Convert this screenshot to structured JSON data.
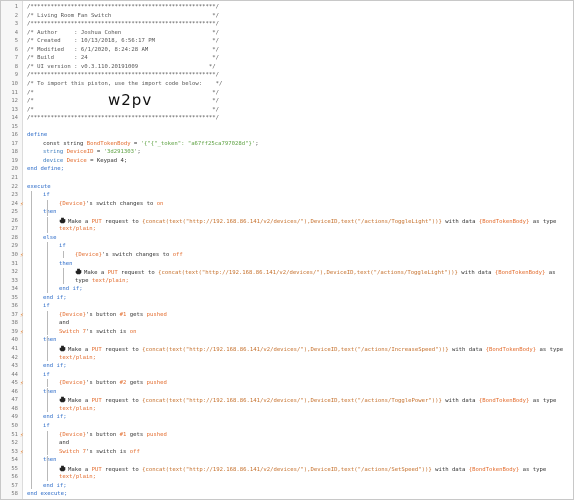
{
  "editor": {
    "lines": [
      {
        "n": "1",
        "i": 0,
        "c": "cm",
        "p": [
          [
            "/*******************************************************/"
          ]
        ]
      },
      {
        "n": "2",
        "i": 0,
        "c": "cm",
        "p": [
          [
            "/* Living Room Fan Switch                              */"
          ]
        ]
      },
      {
        "n": "3",
        "i": 0,
        "c": "cm",
        "p": [
          [
            "/*******************************************************/"
          ]
        ]
      },
      {
        "n": "4",
        "i": 0,
        "c": "cm",
        "p": [
          [
            "/* Author     : Joshua Cohen                           */"
          ]
        ]
      },
      {
        "n": "5",
        "i": 0,
        "c": "cm",
        "p": [
          [
            "/* Created    : 10/13/2018, 6:56:17 PM                 */"
          ]
        ]
      },
      {
        "n": "6",
        "i": 0,
        "c": "cm",
        "p": [
          [
            "/* Modified   : 6/1/2020, 8:24:28 AM                   */"
          ]
        ]
      },
      {
        "n": "7",
        "i": 0,
        "c": "cm",
        "p": [
          [
            "/* Build      : 24                                     */"
          ]
        ]
      },
      {
        "n": "8",
        "i": 0,
        "c": "cm",
        "p": [
          [
            "/* UI version : v0.3.110.20191009                     */"
          ]
        ]
      },
      {
        "n": "9",
        "i": 0,
        "c": "cm",
        "p": [
          [
            "/*******************************************************/"
          ]
        ]
      },
      {
        "n": "10",
        "i": 0,
        "c": "cm",
        "p": [
          [
            "/* To import this piston, use the import code below:    */"
          ]
        ]
      },
      {
        "n": "11",
        "i": 0,
        "c": "cm",
        "p": [
          [
            "/*                                                     */"
          ]
        ]
      },
      {
        "n": "12",
        "i": 0,
        "c": "cm",
        "p": [
          [
            "/*                                                     */"
          ]
        ]
      },
      {
        "n": "13",
        "i": 0,
        "c": "cm",
        "p": [
          [
            "/*                                                     */"
          ]
        ]
      },
      {
        "n": "14",
        "i": 0,
        "c": "cm",
        "p": [
          [
            "/*******************************************************/"
          ]
        ]
      },
      {
        "n": "15",
        "i": 0,
        "c": "",
        "p": []
      },
      {
        "n": "16",
        "i": 0,
        "c": "kw",
        "p": [
          [
            "define"
          ]
        ]
      },
      {
        "n": "17",
        "i": 1,
        "c": "",
        "p": [
          [
            "const string ",
            ""
          ],
          [
            "BondTokenBody",
            "var"
          ],
          [
            " = ",
            ""
          ],
          [
            "'{\"{\"_token\": \"a67ff25ca797028d\"}'",
            "str"
          ],
          [
            ";",
            ""
          ]
        ]
      },
      {
        "n": "18",
        "i": 1,
        "c": "",
        "p": [
          [
            "string ",
            "typ"
          ],
          [
            "DeviceID",
            "var"
          ],
          [
            " = ",
            ""
          ],
          [
            "'3d291303'",
            "str"
          ],
          [
            ";",
            ""
          ]
        ]
      },
      {
        "n": "19",
        "i": 1,
        "c": "",
        "p": [
          [
            "device ",
            "typ"
          ],
          [
            "Device",
            "var"
          ],
          [
            " = Keypad 4;",
            ""
          ]
        ]
      },
      {
        "n": "20",
        "i": 0,
        "c": "kw",
        "p": [
          [
            "end define;"
          ]
        ]
      },
      {
        "n": "21",
        "i": 0,
        "c": "",
        "p": []
      },
      {
        "n": "22",
        "i": 0,
        "c": "kw",
        "p": [
          [
            "execute"
          ]
        ]
      },
      {
        "n": "23",
        "i": 1,
        "c": "kw",
        "p": [
          [
            "if"
          ]
        ]
      },
      {
        "n": "24",
        "i": 2,
        "c": "",
        "f": true,
        "p": [
          [
            "{Device}",
            "var"
          ],
          [
            "'s switch changes to ",
            ""
          ],
          [
            "on",
            "var"
          ]
        ]
      },
      {
        "n": "25",
        "i": 1,
        "c": "kw",
        "p": [
          [
            "then"
          ]
        ]
      },
      {
        "n": "26",
        "i": 2,
        "c": "",
        "ic": true,
        "p": [
          [
            "Make a ",
            ""
          ],
          [
            "PUT",
            "var"
          ],
          [
            " request to ",
            ""
          ],
          [
            "{concat(text(\"http://192.168.86.141/v2/devices/\"),DeviceID,text(\"/actions/ToggleLight\"))}",
            "str2"
          ],
          [
            " with data ",
            ""
          ],
          [
            "{BondTokenBody}",
            "var"
          ],
          [
            " as type",
            ""
          ]
        ]
      },
      {
        "n": "27",
        "i": 2,
        "c": "",
        "p": [
          [
            "text/plain;",
            "var"
          ]
        ]
      },
      {
        "n": "28",
        "i": 1,
        "c": "kw",
        "p": [
          [
            "else"
          ]
        ]
      },
      {
        "n": "29",
        "i": 2,
        "c": "kw",
        "p": [
          [
            "if"
          ]
        ]
      },
      {
        "n": "30",
        "i": 3,
        "c": "",
        "f": true,
        "p": [
          [
            "{Device}",
            "var"
          ],
          [
            "'s switch changes to ",
            ""
          ],
          [
            "off",
            "var"
          ]
        ]
      },
      {
        "n": "31",
        "i": 2,
        "c": "kw",
        "p": [
          [
            "then"
          ]
        ]
      },
      {
        "n": "32",
        "i": 3,
        "c": "",
        "ic": true,
        "p": [
          [
            "Make a ",
            ""
          ],
          [
            "PUT",
            "var"
          ],
          [
            " request to ",
            ""
          ],
          [
            "{concat(text(\"http://192.168.86.141/v2/devices/\"),DeviceID,text(\"/actions/ToggleLight\"))}",
            "str2"
          ],
          [
            " with data ",
            ""
          ],
          [
            "{BondTokenBody}",
            "var"
          ],
          [
            " as",
            ""
          ]
        ]
      },
      {
        "n": "33",
        "i": 3,
        "c": "",
        "p": [
          [
            "type ",
            ""
          ],
          [
            "text/plain;",
            "var"
          ]
        ]
      },
      {
        "n": "34",
        "i": 2,
        "c": "kw",
        "p": [
          [
            "end if;"
          ]
        ]
      },
      {
        "n": "35",
        "i": 1,
        "c": "kw",
        "p": [
          [
            "end if;"
          ]
        ]
      },
      {
        "n": "36",
        "i": 1,
        "c": "kw",
        "p": [
          [
            "if"
          ]
        ]
      },
      {
        "n": "37",
        "i": 2,
        "c": "",
        "f": true,
        "p": [
          [
            "{Device}",
            "var"
          ],
          [
            "'s button ",
            ""
          ],
          [
            "#1",
            "var"
          ],
          [
            " gets ",
            ""
          ],
          [
            "pushed",
            "var"
          ]
        ]
      },
      {
        "n": "38",
        "i": 2,
        "c": "",
        "p": [
          [
            "and",
            ""
          ]
        ]
      },
      {
        "n": "39",
        "i": 2,
        "c": "",
        "f": true,
        "p": [
          [
            "Switch 7",
            "var"
          ],
          [
            "'s switch is ",
            ""
          ],
          [
            "on",
            "var"
          ]
        ]
      },
      {
        "n": "40",
        "i": 1,
        "c": "kw",
        "p": [
          [
            "then"
          ]
        ]
      },
      {
        "n": "41",
        "i": 2,
        "c": "",
        "ic": true,
        "p": [
          [
            "Make a ",
            ""
          ],
          [
            "PUT",
            "var"
          ],
          [
            " request to ",
            ""
          ],
          [
            "{concat(text(\"http://192.168.86.141/v2/devices/\"),DeviceID,text(\"/actions/IncreaseSpeed\"))}",
            "str2"
          ],
          [
            " with data ",
            ""
          ],
          [
            "{BondTokenBody}",
            "var"
          ],
          [
            " as type",
            ""
          ]
        ]
      },
      {
        "n": "42",
        "i": 2,
        "c": "",
        "p": [
          [
            "text/plain;",
            "var"
          ]
        ]
      },
      {
        "n": "43",
        "i": 1,
        "c": "kw",
        "p": [
          [
            "end if;"
          ]
        ]
      },
      {
        "n": "44",
        "i": 1,
        "c": "kw",
        "p": [
          [
            "if"
          ]
        ]
      },
      {
        "n": "45",
        "i": 2,
        "c": "",
        "f": true,
        "p": [
          [
            "{Device}",
            "var"
          ],
          [
            "'s button ",
            ""
          ],
          [
            "#2",
            "var"
          ],
          [
            " gets ",
            ""
          ],
          [
            "pushed",
            "var"
          ]
        ]
      },
      {
        "n": "46",
        "i": 1,
        "c": "kw",
        "p": [
          [
            "then"
          ]
        ]
      },
      {
        "n": "47",
        "i": 2,
        "c": "",
        "ic": true,
        "p": [
          [
            "Make a ",
            ""
          ],
          [
            "PUT",
            "var"
          ],
          [
            " request to ",
            ""
          ],
          [
            "{concat(text(\"http://192.168.86.141/v2/devices/\"),DeviceID,text(\"/actions/TogglePower\"))}",
            "str2"
          ],
          [
            " with data ",
            ""
          ],
          [
            "{BondTokenBody}",
            "var"
          ],
          [
            " as type",
            ""
          ]
        ]
      },
      {
        "n": "48",
        "i": 2,
        "c": "",
        "p": [
          [
            "text/plain;",
            "var"
          ]
        ]
      },
      {
        "n": "49",
        "i": 1,
        "c": "kw",
        "p": [
          [
            "end if;"
          ]
        ]
      },
      {
        "n": "50",
        "i": 1,
        "c": "kw",
        "p": [
          [
            "if"
          ]
        ]
      },
      {
        "n": "51",
        "i": 2,
        "c": "",
        "f": true,
        "p": [
          [
            "{Device}",
            "var"
          ],
          [
            "'s button ",
            ""
          ],
          [
            "#1",
            "var"
          ],
          [
            " gets ",
            ""
          ],
          [
            "pushed",
            "var"
          ]
        ]
      },
      {
        "n": "52",
        "i": 2,
        "c": "",
        "p": [
          [
            "and",
            ""
          ]
        ]
      },
      {
        "n": "53",
        "i": 2,
        "c": "",
        "f": true,
        "p": [
          [
            "Switch 7",
            "var"
          ],
          [
            "'s switch is ",
            ""
          ],
          [
            "off",
            "var"
          ]
        ]
      },
      {
        "n": "54",
        "i": 1,
        "c": "kw",
        "p": [
          [
            "then"
          ]
        ]
      },
      {
        "n": "55",
        "i": 2,
        "c": "",
        "ic": true,
        "p": [
          [
            "Make a ",
            ""
          ],
          [
            "PUT",
            "var"
          ],
          [
            " request to ",
            ""
          ],
          [
            "{concat(text(\"http://192.168.86.141/v2/devices/\"),DeviceID,text(\"/actions/SetSpeed\"))}",
            "str2"
          ],
          [
            " with data ",
            ""
          ],
          [
            "{BondTokenBody}",
            "var"
          ],
          [
            " as type",
            ""
          ]
        ]
      },
      {
        "n": "56",
        "i": 2,
        "c": "",
        "p": [
          [
            "text/plain;",
            "var"
          ]
        ]
      },
      {
        "n": "57",
        "i": 1,
        "c": "kw",
        "p": [
          [
            "end if;"
          ]
        ]
      },
      {
        "n": "58",
        "i": 0,
        "c": "kw",
        "p": [
          [
            "end execute;"
          ]
        ]
      }
    ],
    "import_code": "w2pv",
    "trigger_flag": "⚡",
    "action_icon": "fist-bump-icon",
    "colors": {
      "variable": "#e36b2c",
      "string": "#5a9f3e",
      "type": "#3a7bbd",
      "keyword": "#2a6ac8",
      "comment": "#555555",
      "flag": "#e8812e"
    }
  }
}
